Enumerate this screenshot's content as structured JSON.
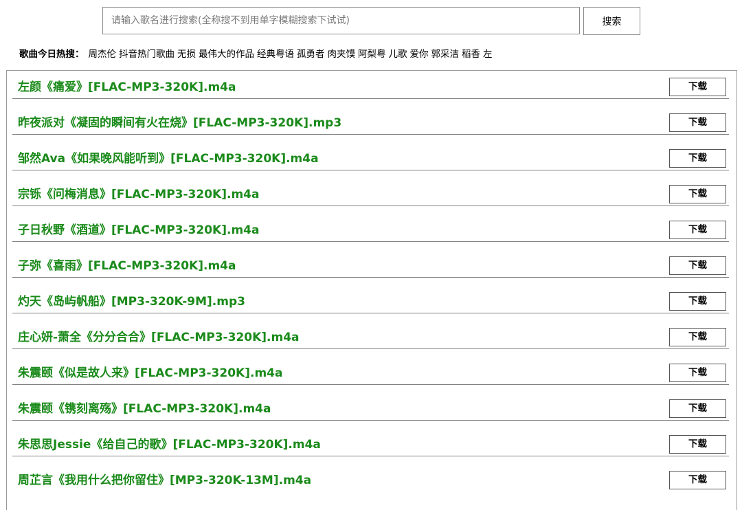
{
  "search": {
    "placeholder": "请输入歌名进行搜索(全称搜不到用单字模糊搜索下试试)",
    "button_label": "搜索"
  },
  "hot": {
    "label": "歌曲今日热搜：",
    "items": [
      "周杰伦",
      "抖音热门歌曲",
      "无损",
      "最伟大的作品",
      "经典粤语",
      "孤勇者",
      "肉夹馍",
      "阿梨粤",
      "儿歌",
      "爱你",
      "郭采洁",
      "稻香",
      "左"
    ]
  },
  "results": {
    "download_label": "下载",
    "songs": [
      "左颜《痛爱》[FLAC-MP3-320K].m4a",
      "昨夜派对《凝固的瞬间有火在烧》[FLAC-MP3-320K].mp3",
      "邹然Ava《如果晚风能听到》[FLAC-MP3-320K].m4a",
      "宗铄《问梅消息》[FLAC-MP3-320K].m4a",
      "子日秋野《酒道》[FLAC-MP3-320K].m4a",
      "子弥《喜雨》[FLAC-MP3-320K].m4a",
      "灼天《岛屿帆船》[MP3-320K-9M].mp3",
      "庄心妍-萧全《分分合合》[FLAC-MP3-320K].m4a",
      "朱震颐《似是故人来》[FLAC-MP3-320K].m4a",
      "朱震颐《镌刻离殇》[FLAC-MP3-320K].m4a",
      "朱思思Jessie《给自己的歌》[FLAC-MP3-320K].m4a",
      "周芷言《我用什么把你留住》[MP3-320K-13M].m4a"
    ]
  },
  "colors": {
    "song_link": "#1a8a1a"
  }
}
